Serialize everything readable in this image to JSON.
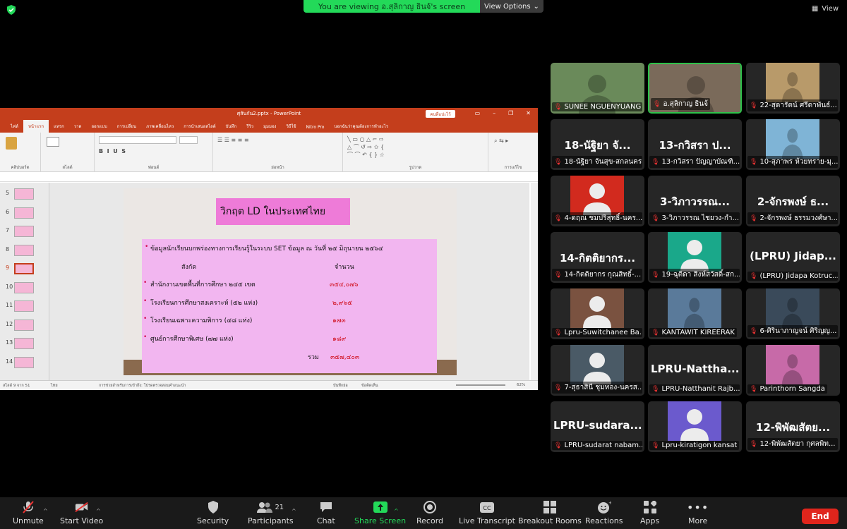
{
  "banner": {
    "text": "You are viewing อ.สุลิกาญ ธินจ้'s screen",
    "view_options": "View Options"
  },
  "view_label": "View",
  "ppt": {
    "filename": "ศุสันกัน2.pptx - PowerPoint",
    "share_label": "คนที่แปะไว้",
    "tabs": [
      "ไฟล์",
      "หน้าแรก",
      "แทรก",
      "วาด",
      "ออกแบบ",
      "การเปลี่ยน",
      "ภาพเคลื่อนไหว",
      "การนำเสนอสไลด์",
      "บันทึก",
      "รีวิว",
      "มุมมอง",
      "วิธีใช้",
      "Nitro Pro",
      "บอกฉันว่าคุณต้องการทำอะไร"
    ],
    "ribbon_groups": [
      "คลิปบอร์ด",
      "สไลด์",
      "ฟอนต์",
      "ย่อหน้า",
      "รูปวาด",
      "การแก้ไข"
    ],
    "slide_numbers": [
      "5",
      "6",
      "7",
      "8",
      "9",
      "10",
      "11",
      "12",
      "13",
      "14"
    ],
    "selected_slide": "9",
    "status_left": "สไลด์ 9 จาก 51",
    "status_lang": "ไทย",
    "status_access": "การช่วยสำหรับการเข้าถึง: โปรดตรวจสอบคำแนะนำ",
    "status_notes": "บันทึกย่อ",
    "status_comments": "ข้อคิดเห็น",
    "zoom": "62%",
    "slide": {
      "title": "วิกฤต LD ในประเทศไทย",
      "bullet1": "ข้อมูลนักเรียนบกพร่องทางการเรียนรู้ในระบบ SET ข้อมูล ณ วันที่ ๒๕ มิถุนายน ๒๕๖๔",
      "col1": "สังกัด",
      "col2": "จำนวน",
      "rows": [
        {
          "label": "สำนักงานเขตพื้นที่การศึกษา ๒๔๕ เขต",
          "value": "๓๕๔,๐๗๖"
        },
        {
          "label": "โรงเรียนการศึกษาสงเคราะห์ (๕๒ แห่ง)",
          "value": "๒,๙๖๕"
        },
        {
          "label": "โรงเรียนเฉพาะความพิการ (๔๘ แห่ง)",
          "value": "๑๗๓"
        },
        {
          "label": "ศูนย์การศึกษาพิเศษ (๗๗ แห่ง)",
          "value": "๑๘๙"
        }
      ],
      "total_label": "รวม",
      "total_value": "๓๕๗,๔๐๓"
    }
  },
  "participants": [
    {
      "name": "SUNEE NGUENYUANG",
      "big": "",
      "type": "cam",
      "color": "#6a8a5a"
    },
    {
      "name": "อ.สุลิกาญ ธินจ้",
      "big": "",
      "type": "cam",
      "color": "#7a6a5a",
      "active": true
    },
    {
      "name": "22-สุดารัตน์ ศรีดาพันธ์...",
      "big": "",
      "type": "pic",
      "color": "#b89a6a"
    },
    {
      "name": "18-นัฐิยา จันสุข-สกลนคร",
      "big": "18-นัฐิยา จั...",
      "type": "text"
    },
    {
      "name": "13-กวิสรา ปัญญาบัณฑิ...",
      "big": "13-กวิสรา ป...",
      "type": "text"
    },
    {
      "name": "10-สุภาพร ห้วยทราย-มุ...",
      "big": "",
      "type": "pic",
      "color": "#7fb4d6"
    },
    {
      "name": "4-ดฤณ ชมปริสุทธิ์-นคร...",
      "big": "",
      "type": "avatar",
      "color": "#d22a1e"
    },
    {
      "name": "3-วิภาวรรณ ไชยวง-กำ...",
      "big": "3-วิภาวรรณ...",
      "type": "text"
    },
    {
      "name": "2-จักรพงษ์ ธรรมวงศ์ษา...",
      "big": "2-จักรพงษ์ ธ...",
      "type": "text"
    },
    {
      "name": "14-กิตติยากร กุณสิทธิ์-...",
      "big": "14-กิตติยากร...",
      "type": "text"
    },
    {
      "name": "19-ฉุติดา สิงห์สวัสดิ์-สก...",
      "big": "",
      "type": "avatar",
      "color": "#1aa88a"
    },
    {
      "name": "(LPRU) Jidapa Kotruc...",
      "big": "(LPRU) Jidap...",
      "type": "text"
    },
    {
      "name": "Lpru-Suwitchanee Ba...",
      "big": "",
      "type": "avatar",
      "color": "#7a5240"
    },
    {
      "name": "KANTAWIT KIREERAK",
      "big": "",
      "type": "pic",
      "color": "#5a7a9a"
    },
    {
      "name": "6-ศิรินาภาญจน์ ศิริญญ...",
      "big": "",
      "type": "pic",
      "color": "#3a4a5a"
    },
    {
      "name": "7-สุธาสินี ชุมทอง-นครส...",
      "big": "",
      "type": "avatar",
      "color": "#4a5a66"
    },
    {
      "name": "LPRU-Natthanit Rajb...",
      "big": "LPRU-Nattha...",
      "type": "text"
    },
    {
      "name": "Parinthorn Sangda",
      "big": "",
      "type": "pic",
      "color": "#c76aa8"
    },
    {
      "name": "LPRU-sudarat nabam...",
      "big": "LPRU-sudara...",
      "type": "text"
    },
    {
      "name": "Lpru-kiratigon kansat",
      "big": "",
      "type": "avatar",
      "color": "#6b5acd"
    },
    {
      "name": "12-พิพัฒสัตยา กุศลพิท...",
      "big": "12-พิพัฒสัตย...",
      "type": "text"
    }
  ],
  "toolbar": {
    "unmute": "Unmute",
    "start_video": "Start Video",
    "security": "Security",
    "participants": "Participants",
    "participants_count": "21",
    "chat": "Chat",
    "share_screen": "Share Screen",
    "record": "Record",
    "live_transcript": "Live Transcript",
    "breakout_rooms": "Breakout Rooms",
    "reactions": "Reactions",
    "apps": "Apps",
    "more": "More",
    "end": "End"
  },
  "colors": {
    "accent_green": "#23d959",
    "ppt_red": "#c43e1c",
    "end_red": "#e0251c"
  }
}
